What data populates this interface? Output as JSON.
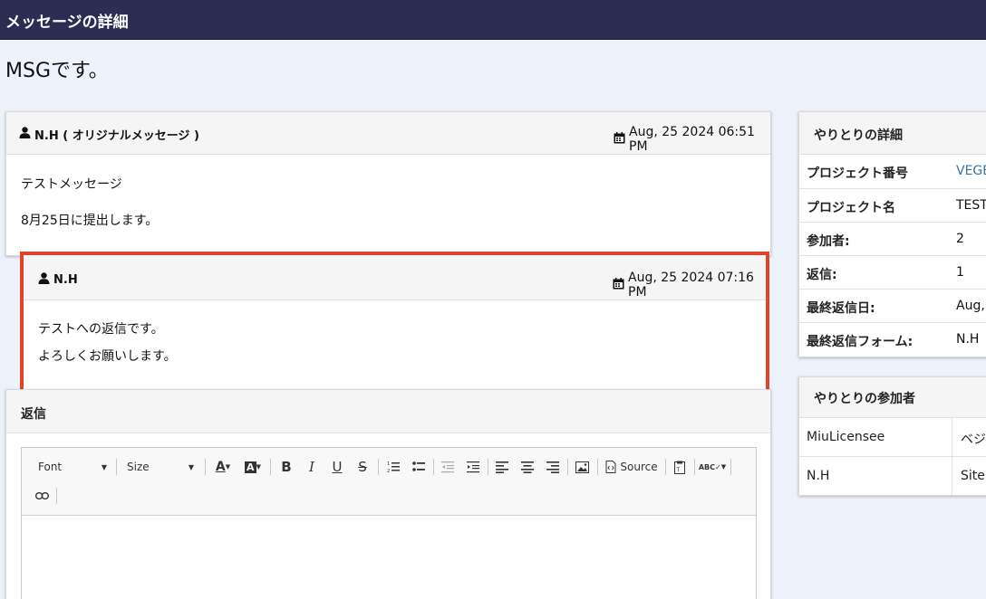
{
  "window": {
    "title": "メッセージの詳細"
  },
  "page": {
    "title": "MSGです。"
  },
  "messages": [
    {
      "author": "N.H ( オリジナルメッセージ )",
      "date": "Aug, 25 2024 06:51 PM",
      "lines": [
        "テストメッセージ",
        "8月25日に提出します。"
      ]
    },
    {
      "author": "N.H",
      "date": "Aug, 25 2024 07:16 PM",
      "lines": [
        "テストへの返信です。",
        "よろしくお願いします。"
      ],
      "highlight_color": "#e0442a"
    }
  ],
  "reply": {
    "label": "返信",
    "toolbar": {
      "font_label": "Font",
      "size_label": "Size",
      "source_label": "Source",
      "buttons": [
        "text-color",
        "bg-color",
        "bold",
        "italic",
        "underline",
        "strike",
        "numbered-list",
        "bullet-list",
        "outdent",
        "indent",
        "align-left",
        "align-center",
        "align-right",
        "image",
        "source",
        "paste-text",
        "spellcheck",
        "link"
      ]
    }
  },
  "details": {
    "title": "やりとりの詳細",
    "rows": [
      {
        "label": "プロジェクト番号",
        "value": "VEGE"
      },
      {
        "label": "プロジェクト名",
        "value": "TEST"
      },
      {
        "label": "参加者:",
        "value": "2"
      },
      {
        "label": "返信:",
        "value": "1"
      },
      {
        "label": "最終返信日:",
        "value": "Aug,"
      },
      {
        "label": "最終返信フォーム:",
        "value": "N.H"
      }
    ],
    "link_color": "#3a73a8"
  },
  "participants": {
    "title": "やりとりの参加者",
    "rows": [
      {
        "name": "MiuLicensee",
        "role": "ベジ"
      },
      {
        "name": "N.H",
        "role": "Site A"
      }
    ]
  },
  "colors": {
    "topbar": "#2b2d52",
    "background": "#eef2fb"
  }
}
